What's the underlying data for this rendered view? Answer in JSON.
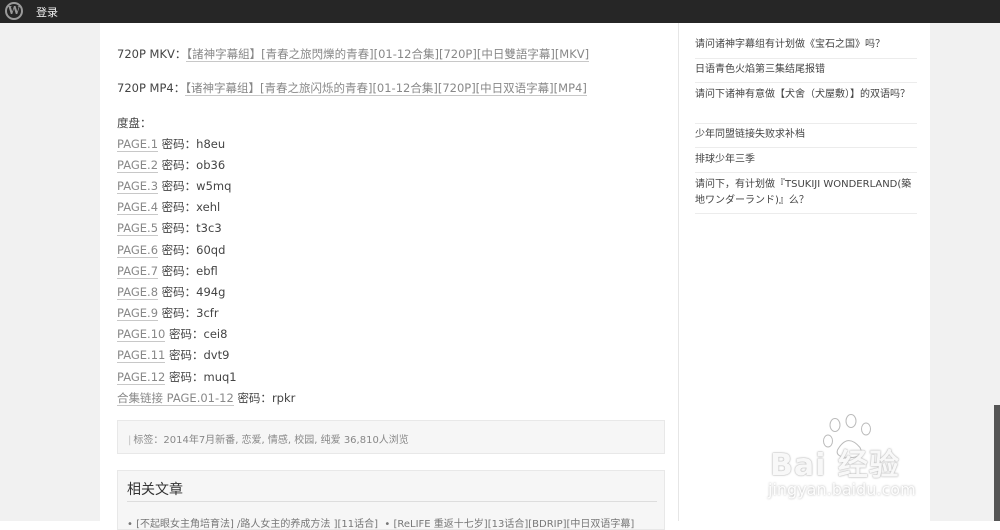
{
  "adminbar": {
    "login": "登录"
  },
  "article": {
    "mkv_label": "720P MKV：",
    "mkv_link": "【諸神字幕組】[青春之旅閃爍的青春][01-12合集][720P][中日雙語字幕][MKV]",
    "mp4_label": "720P MP4：",
    "mp4_link": "【诸神字幕组】[青春之旅闪烁的青春][01-12合集][720P][中日双语字幕][MP4]",
    "baidu_label": "度盘：",
    "password_label": "密码：",
    "pages": [
      {
        "link": "PAGE.1",
        "code": "h8eu"
      },
      {
        "link": "PAGE.2",
        "code": "ob36"
      },
      {
        "link": "PAGE.3",
        "code": "w5mq"
      },
      {
        "link": "PAGE.4",
        "code": "xehl"
      },
      {
        "link": "PAGE.5",
        "code": "t3c3"
      },
      {
        "link": "PAGE.6",
        "code": "60qd"
      },
      {
        "link": "PAGE.7",
        "code": "ebfl"
      },
      {
        "link": "PAGE.8",
        "code": "494g"
      },
      {
        "link": "PAGE.9",
        "code": "3cfr"
      },
      {
        "link": "PAGE.10",
        "code": "cei8"
      },
      {
        "link": "PAGE.11",
        "code": "dvt9"
      },
      {
        "link": "PAGE.12",
        "code": "muq1"
      }
    ],
    "collection": {
      "link": "合集链接 PAGE.01-12",
      "code": "rpkr"
    }
  },
  "tags": {
    "label": "标签：",
    "items": [
      "2014年7月新番",
      "恋爱",
      "情感",
      "校园",
      "纯爱"
    ],
    "views": "36,810人浏览"
  },
  "related": {
    "title": "相关文章",
    "items": [
      "[不起眼女主角培育法] /路人女主的养成方法 ][11话合]",
      "[ReLIFE 重返十七岁][13话合][BDRIP][中日双语字幕]"
    ]
  },
  "sidebar": {
    "items": [
      "请问诸神字幕组有计划做《宝石之国》吗？",
      "日语青色火焰第三集结尾报错",
      "请问下诸神有意做【犬舍（犬屋敷）】的双语吗？",
      "少年同盟链接失败求补档",
      "排球少年三季",
      "请问下，有计划做『TSUKIJI WONDERLAND(築地ワンダーランド)』么？"
    ]
  },
  "watermark": {
    "brand": "Bai 经验",
    "url": "jingyan.baidu.com"
  }
}
